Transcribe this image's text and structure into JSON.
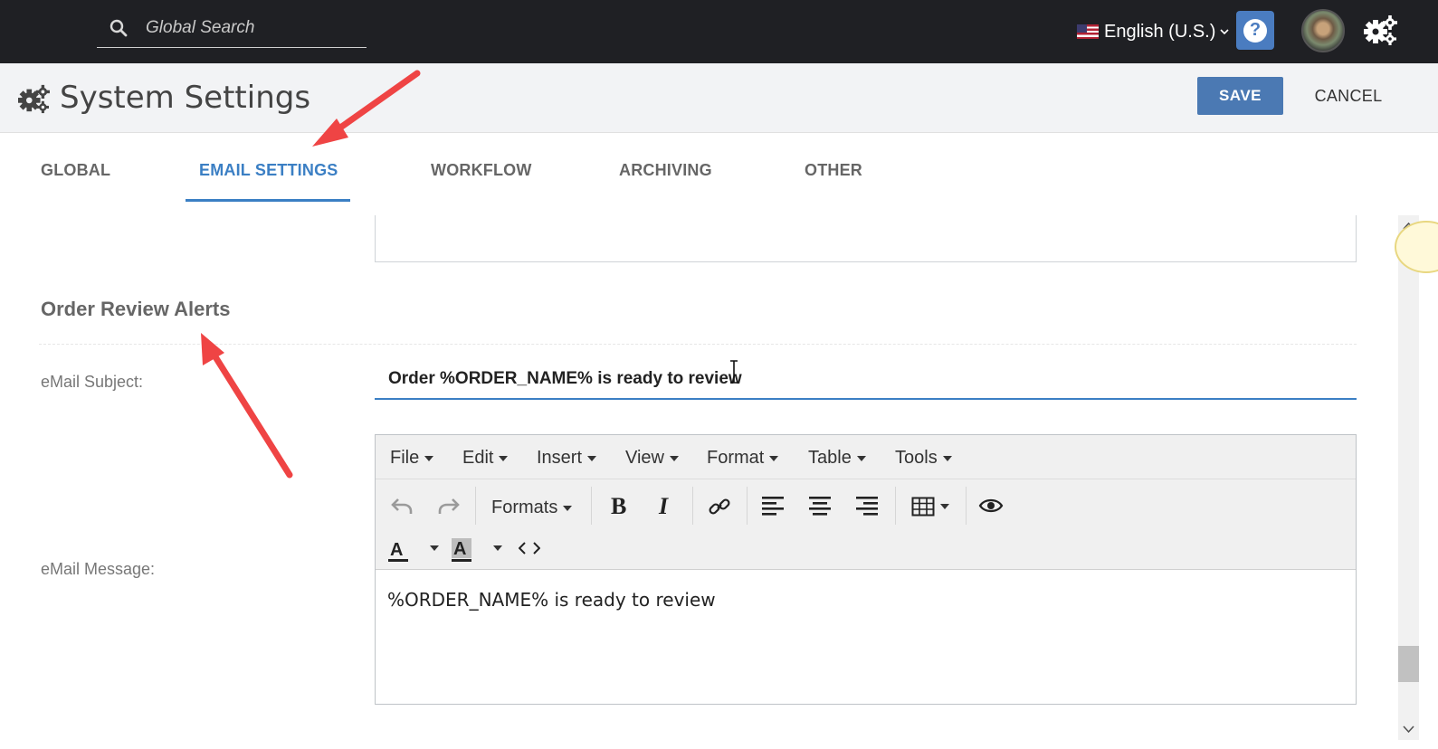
{
  "topbar": {
    "search_placeholder": "Global Search",
    "language": "English (U.S.)",
    "help_label": "?"
  },
  "header": {
    "title": "System Settings",
    "save_label": "SAVE",
    "cancel_label": "CANCEL"
  },
  "tabs": [
    {
      "label": "GLOBAL",
      "active": false
    },
    {
      "label": "EMAIL SETTINGS",
      "active": true
    },
    {
      "label": "WORKFLOW",
      "active": false
    },
    {
      "label": "ARCHIVING",
      "active": false
    },
    {
      "label": "OTHER",
      "active": false
    }
  ],
  "section": {
    "title": "Order Review Alerts",
    "subject_label": "eMail Subject:",
    "subject_value": "Order %ORDER_NAME% is ready to review",
    "message_label": "eMail Message:"
  },
  "editor": {
    "menus": [
      "File",
      "Edit",
      "Insert",
      "View",
      "Format",
      "Table",
      "Tools"
    ],
    "formats_label": "Formats",
    "content": "%ORDER_NAME% is ready to review"
  },
  "colors": {
    "accent": "#3b7fc4",
    "save_button": "#4b79b3",
    "topbar": "#1f2024",
    "annotation_arrow": "#ef4444"
  }
}
